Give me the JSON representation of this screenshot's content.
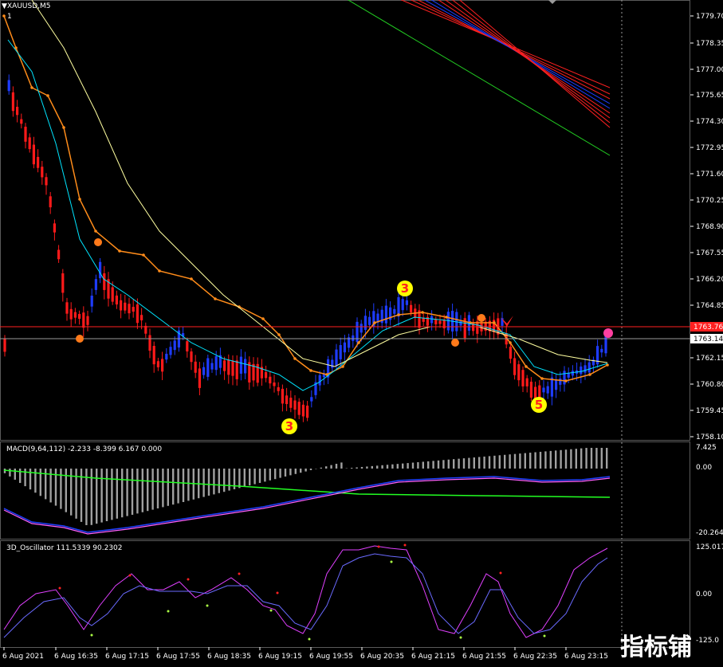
{
  "symbol_label": "XAUUSD,M5",
  "window_index": "1",
  "current_price": "1763.14",
  "red_line_price": "1763.76",
  "price_axis": [
    "1779.70",
    "1778.35",
    "1777.00",
    "1775.65",
    "1774.30",
    "1772.95",
    "1771.60",
    "1770.25",
    "1768.90",
    "1767.55",
    "1766.20",
    "1764.85",
    "1762.15",
    "1760.80",
    "1759.45",
    "1758.10"
  ],
  "macd_label": "MACD(9,64,112) -2.233 -8.399 6.167 0.000",
  "macd_axis": [
    "7.425",
    "0.00",
    "-20.264"
  ],
  "osc_label": "3D_Oscillator 111.5339 90.2302",
  "osc_axis": [
    "125.0174",
    "0.00",
    "-125.0"
  ],
  "time_axis": [
    "6 Aug 2021",
    "6 Aug 16:35",
    "6 Aug 17:15",
    "6 Aug 17:55",
    "6 Aug 18:35",
    "6 Aug 19:15",
    "6 Aug 19:55",
    "6 Aug 20:35",
    "6 Aug 21:15",
    "6 Aug 21:55",
    "6 Aug 22:35",
    "6 Aug 23:15"
  ],
  "wave_labels": [
    "3",
    "3",
    "5"
  ],
  "watermark": "指标铺",
  "colors": {
    "bull": "#1e3cff",
    "bear": "#ff1a1a",
    "slow_ma": "#ff8c1a",
    "fast_ma": "#00e5ff",
    "long_ma": "#ffffa0",
    "grid": "#555555",
    "macd_hist": "#a0a0a0",
    "signal": "#22ff22",
    "macd_line": "#ff60ff"
  }
}
